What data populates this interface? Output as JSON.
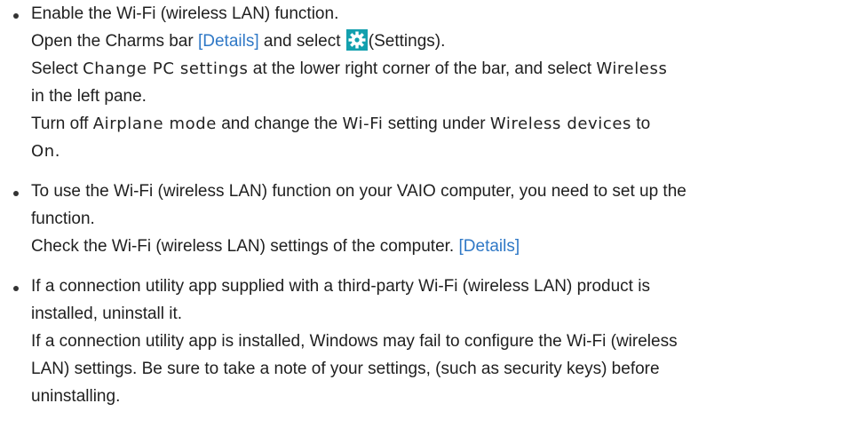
{
  "items": [
    {
      "heading": "Enable the Wi-Fi (wireless LAN) function.",
      "step1": {
        "pre": "Open the Charms bar ",
        "link": "[Details]",
        "mid": " and select ",
        "post": "(Settings)."
      },
      "step2": {
        "pre": "Select ",
        "ui1": "Change PC settings",
        "mid": " at the lower right corner of the bar, and select ",
        "ui2": "Wireless",
        "post": "in the left pane."
      },
      "step3": {
        "pre": "Turn off ",
        "ui1": "Airplane mode",
        "mid1": " and change the ",
        "ui2": "Wi-Fi",
        "mid2": " setting under ",
        "ui3": "Wireless devices",
        "mid3": " to",
        "ui4": "On."
      }
    },
    {
      "heading_line1": "To use the Wi-Fi (wireless LAN) function on your VAIO computer, you need to set up the",
      "heading_line2": "function.",
      "note_pre": "Check the Wi-Fi (wireless LAN) settings of the computer. ",
      "note_link": "[Details]"
    },
    {
      "heading_line1": "If a connection utility app supplied with a third-party Wi-Fi (wireless LAN) product is",
      "heading_line2": "installed, uninstall it.",
      "note_line1": "If a connection utility app is installed, Windows may fail to configure the Wi-Fi (wireless",
      "note_line2": "LAN) settings. Be sure to take a note of your settings, (such as security keys) before",
      "note_line3": "uninstalling."
    }
  ],
  "icons": {
    "settings": "gear-icon"
  },
  "colors": {
    "link": "#2f78c6",
    "gear_bg": "#13a0ae",
    "text": "#1f1f1f"
  }
}
